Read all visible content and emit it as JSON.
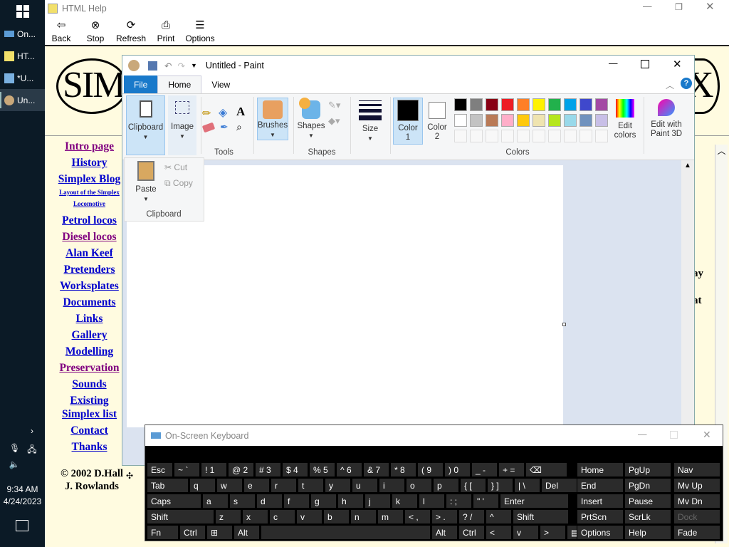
{
  "taskbar": {
    "items": [
      {
        "label": "On..."
      },
      {
        "label": "HT..."
      },
      {
        "label": "*U..."
      },
      {
        "label": "Un..."
      }
    ],
    "clock_time": "9:34 AM",
    "clock_date": "4/24/2023",
    "chevron": "›"
  },
  "help": {
    "title": "HTML Help",
    "toolbar": {
      "back": "Back",
      "stop": "Stop",
      "refresh": "Refresh",
      "print": "Print",
      "options": "Options"
    },
    "banner_left": "SIMPL",
    "banner_right": "X",
    "nav": [
      {
        "label": "Intro page",
        "visited": true
      },
      {
        "label": "History",
        "visited": false
      },
      {
        "label": "Simplex Blog",
        "visited": false
      },
      {
        "label": "Layout of the Simplex",
        "visited": false,
        "small": true
      },
      {
        "label": "Locomotive",
        "visited": false,
        "small": true
      },
      {
        "label": "Petrol locos",
        "visited": false
      },
      {
        "label": "Diesel locos",
        "visited": true
      },
      {
        "label": "Alan Keef",
        "visited": false
      },
      {
        "label": "Pretenders",
        "visited": false
      },
      {
        "label": "Worksplates",
        "visited": false
      },
      {
        "label": "Documents",
        "visited": false
      },
      {
        "label": "Links",
        "visited": false
      },
      {
        "label": "Gallery",
        "visited": false
      },
      {
        "label": "Modelling",
        "visited": false
      },
      {
        "label": "Preservation",
        "visited": true
      },
      {
        "label": "Sounds",
        "visited": false
      },
      {
        "label": "Existing",
        "visited": false
      },
      {
        "label": "Simplex list",
        "visited": false
      },
      {
        "label": "Contact",
        "visited": false
      },
      {
        "label": "Thanks",
        "visited": false
      }
    ],
    "copyright_1": "© 2002 D.Hall",
    "copyright_2": "J. Rowlands",
    "body_fragment_1": "ay",
    "body_fragment_2": "at"
  },
  "paint": {
    "title": "Untitled - Paint",
    "tabs": {
      "file": "File",
      "home": "Home",
      "view": "View"
    },
    "groups": {
      "clipboard": "Clipboard",
      "image": "Image",
      "tools": "Tools",
      "brushes": "Brushes",
      "shapes": "Shapes",
      "shapes_group": "Shapes",
      "size": "Size",
      "color1": "Color 1",
      "color2": "Color 2",
      "colors": "Colors",
      "edit_colors": "Edit colors",
      "paint3d": "Edit with Paint 3D"
    },
    "palette_row1": [
      "#000000",
      "#7f7f7f",
      "#880015",
      "#ed1c24",
      "#ff7f27",
      "#fff200",
      "#22b14c",
      "#00a2e8",
      "#3f48cc",
      "#a349a4"
    ],
    "palette_row2": [
      "#ffffff",
      "#c3c3c3",
      "#b97a57",
      "#ffaec9",
      "#ffc90e",
      "#efe4b0",
      "#b5e61d",
      "#99d9ea",
      "#7092be",
      "#c8bfe7"
    ],
    "clipboard_popup": {
      "paste": "Paste",
      "cut": "Cut",
      "copy": "Copy",
      "label": "Clipboard"
    }
  },
  "osk": {
    "title": "On-Screen Keyboard",
    "rows": [
      [
        "Esc",
        "~ `",
        "! 1",
        "@ 2",
        "# 3",
        "$ 4",
        "% 5",
        "^ 6",
        "& 7",
        "* 8",
        "( 9",
        ") 0",
        "_ -",
        "+ =",
        "⌫"
      ],
      [
        "Tab",
        "q",
        "w",
        "e",
        "r",
        "t",
        "y",
        "u",
        "i",
        "o",
        "p",
        "{ [",
        "} ]",
        "| \\",
        "Del"
      ],
      [
        "Caps",
        "a",
        "s",
        "d",
        "f",
        "g",
        "h",
        "j",
        "k",
        "l",
        ": ;",
        "\" '",
        "Enter"
      ],
      [
        "Shift",
        "z",
        "x",
        "c",
        "v",
        "b",
        "n",
        "m",
        "< ,",
        "> .",
        "? /",
        "^",
        "Shift"
      ],
      [
        "Fn",
        "Ctrl",
        "⊞",
        "Alt",
        "",
        "Alt",
        "Ctrl",
        "<",
        "v",
        ">",
        "▤"
      ]
    ],
    "nav_keys": [
      [
        "Home",
        "PgUp",
        "Nav"
      ],
      [
        "End",
        "PgDn",
        "Mv Up"
      ],
      [
        "Insert",
        "Pause",
        "Mv Dn"
      ],
      [
        "PrtScn",
        "ScrLk",
        "Dock"
      ],
      [
        "Options",
        "Help",
        "Fade"
      ]
    ]
  }
}
